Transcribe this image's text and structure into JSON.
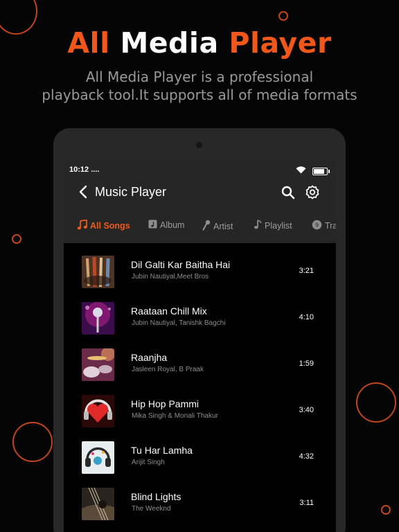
{
  "promo": {
    "headline": {
      "word1": "All",
      "word2": "Media",
      "word3": "Player"
    },
    "subtitle": {
      "line1": "All Media Player is a professional",
      "line2": "playback tool.It supports all of media formats"
    }
  },
  "status_bar": {
    "time": "10:12 ...."
  },
  "app_bar": {
    "title": "Music Player"
  },
  "tabs": [
    {
      "label": "All Songs",
      "icon": "music-note-icon",
      "active": true
    },
    {
      "label": "Album",
      "icon": "album-icon",
      "active": false
    },
    {
      "label": "Artist",
      "icon": "microphone-icon",
      "active": false
    },
    {
      "label": "Playlist",
      "icon": "playlist-note-icon",
      "active": false
    },
    {
      "label": "Tra",
      "icon": "track-icon",
      "active": false
    }
  ],
  "songs": [
    {
      "title": "Dil Galti Kar Baitha Hai",
      "artist": "Jubin Nautiyal,Meet Bros",
      "duration": "3:21",
      "art": "guitars"
    },
    {
      "title": "Raataan Chill Mix",
      "artist": "Jubin Nautiyal, Tanishk Bagchi",
      "duration": "4:10",
      "art": "microphone"
    },
    {
      "title": "Raanjha",
      "artist": "Jasleen Royal, B Praak",
      "duration": "1:59",
      "art": "drums"
    },
    {
      "title": "Hip Hop Pammi",
      "artist": "Mika Singh & Monali Thakur",
      "duration": "3:40",
      "art": "heart-headphones"
    },
    {
      "title": "Tu Har Lamha",
      "artist": "Arijit Singh",
      "duration": "4:32",
      "art": "headphones"
    },
    {
      "title": "Blind Lights",
      "artist": "The Weeknd",
      "duration": "3:11",
      "art": "guitar-closeup"
    }
  ],
  "colors": {
    "accent": "#ef5b1c",
    "ring": "#c2451c",
    "background": "#050505",
    "app_bar": "#262626"
  }
}
